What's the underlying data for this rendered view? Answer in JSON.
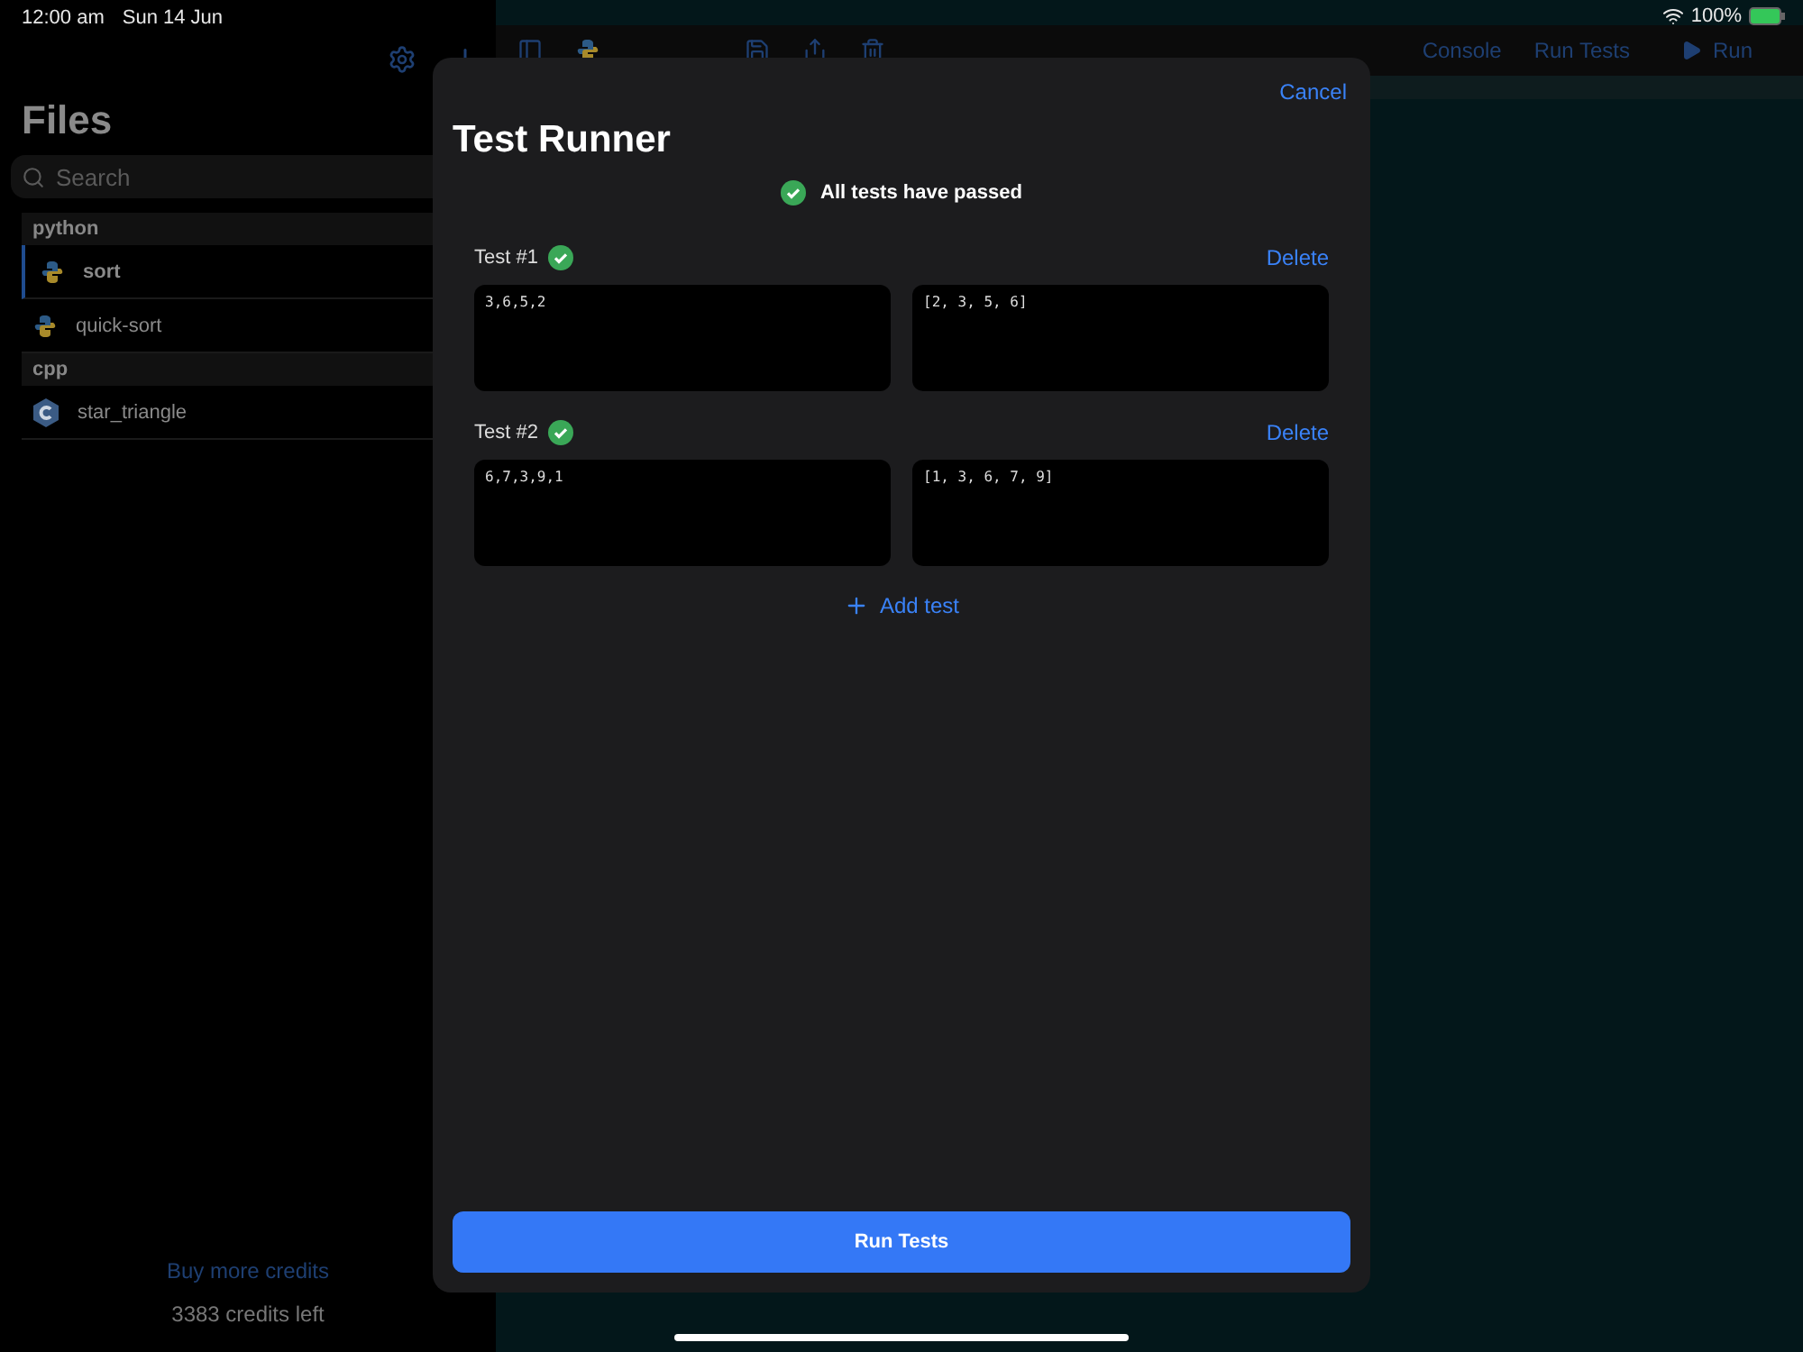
{
  "status_bar": {
    "time": "12:00 am",
    "date": "Sun 14 Jun",
    "battery": "100%"
  },
  "sidebar": {
    "title": "Files",
    "search": {
      "placeholder": "Search"
    },
    "groups": [
      {
        "name": "python",
        "files": [
          {
            "name": "sort",
            "kind": "python",
            "selected": true
          },
          {
            "name": "quick-sort",
            "kind": "python",
            "selected": false
          }
        ]
      },
      {
        "name": "cpp",
        "files": [
          {
            "name": "star_triangle",
            "kind": "cpp",
            "selected": false
          }
        ]
      }
    ],
    "buy_link": "Buy more credits",
    "credits": "3383 credits left"
  },
  "toolbar": {
    "actions": [
      "Console",
      "Run Tests"
    ],
    "run": "Run"
  },
  "modal": {
    "cancel": "Cancel",
    "title": "Test Runner",
    "summary": "All tests have passed",
    "tests": [
      {
        "label": "Test #1",
        "passed": true,
        "input": "3,6,5,2",
        "output": "[2, 3, 5, 6]",
        "delete": "Delete"
      },
      {
        "label": "Test #2",
        "passed": true,
        "input": "6,7,3,9,1",
        "output": "[1, 3, 6, 7, 9]",
        "delete": "Delete"
      }
    ],
    "add_test": "Add test",
    "run_button": "Run Tests"
  }
}
